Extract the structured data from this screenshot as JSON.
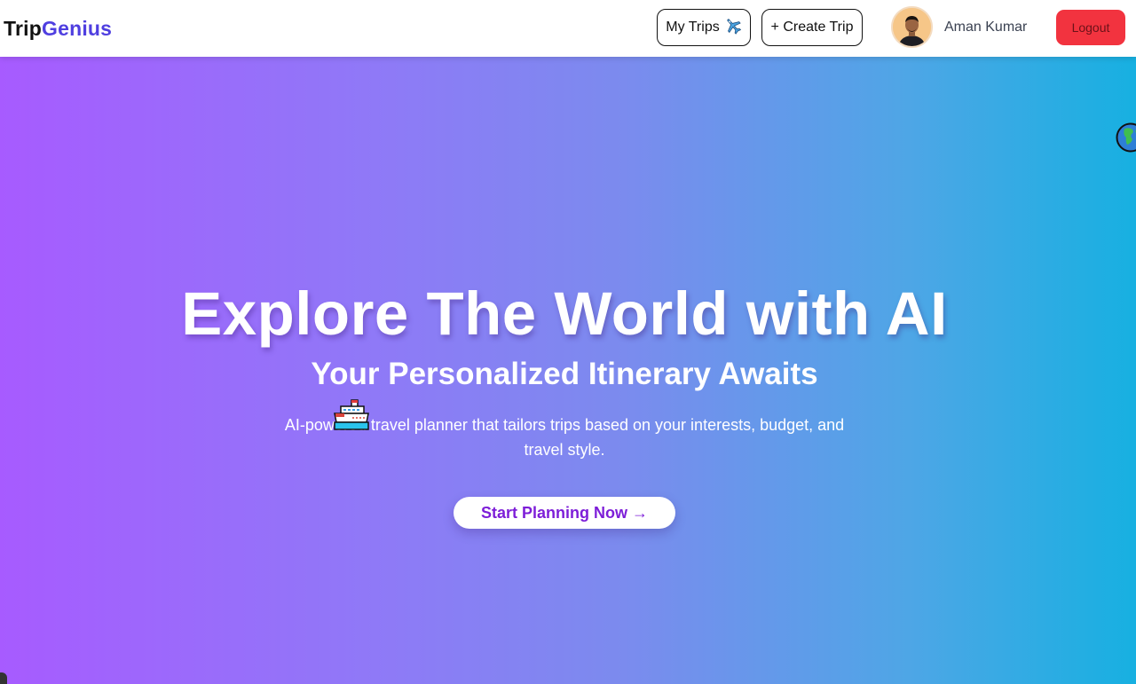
{
  "brand": {
    "part1": "Trip",
    "part2": "Genius"
  },
  "nav": {
    "my_trips_label": "My Trips",
    "my_trips_icon": "airplane-icon",
    "create_trip_label": "+ Create Trip",
    "user_name": "Aman Kumar",
    "logout_label": "Logout"
  },
  "hero": {
    "title": "Explore The World with AI",
    "subtitle": "Your Personalized Itinerary Awaits",
    "description": "AI-powered travel planner that tailors trips based on your interests, budget, and travel style.",
    "cta_label": "Start Planning Now →",
    "floating_icons": [
      "ship-icon",
      "globe-icon"
    ]
  },
  "colors": {
    "brand_dark": "#111111",
    "brand_accent": "#4f3fe0",
    "logout_bg": "#f2333f",
    "cta_text": "#7d1ed8",
    "gradient_start": "#a75bff",
    "gradient_end": "#17b0e1"
  }
}
